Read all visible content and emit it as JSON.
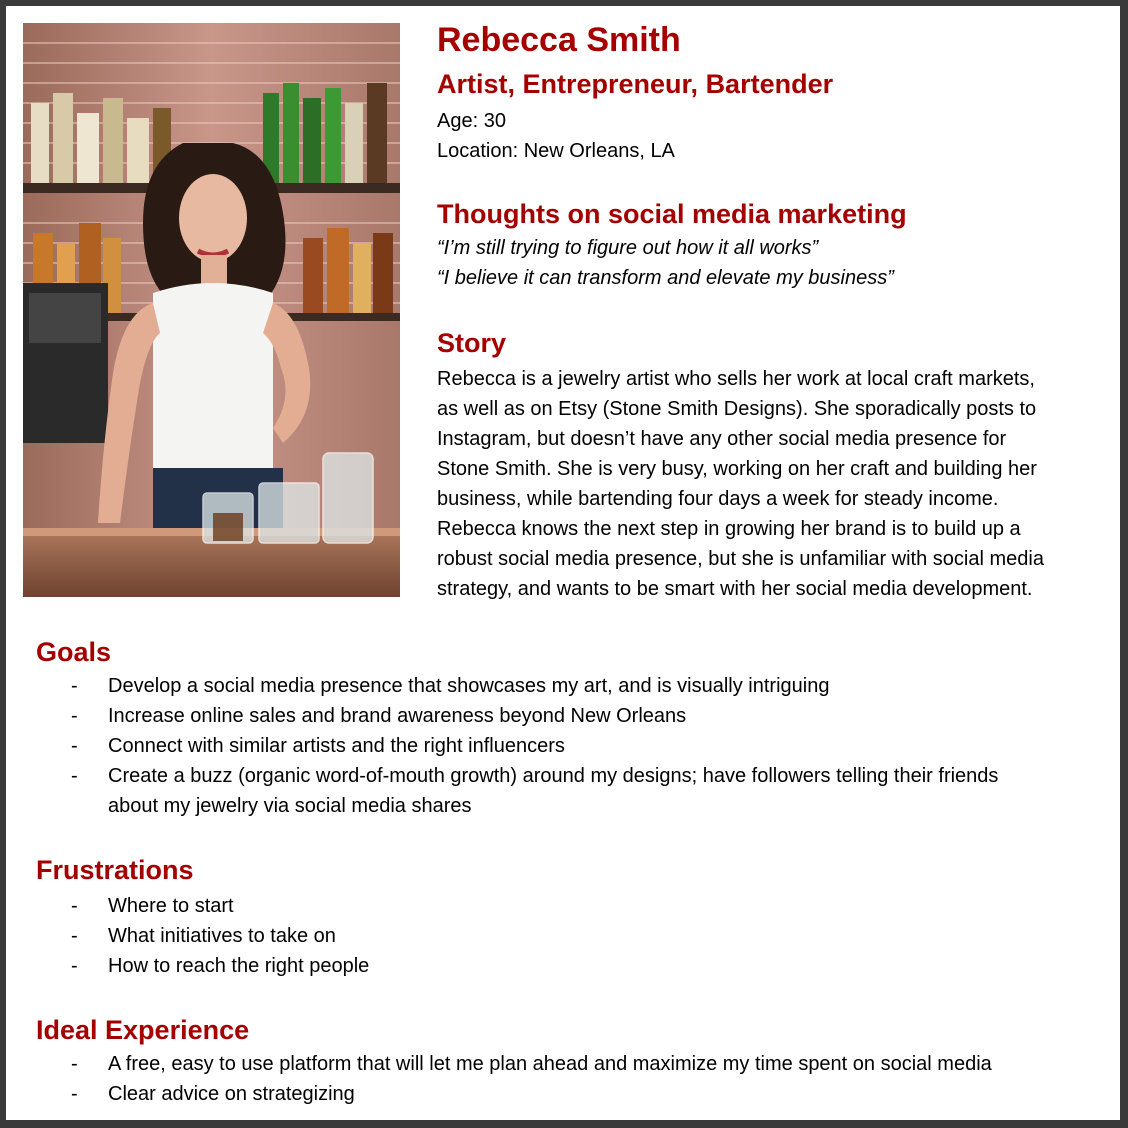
{
  "profile": {
    "name": "Rebecca Smith",
    "roles": "Artist, Entrepreneur, Bartender",
    "age": "Age: 30",
    "location": "Location: New Orleans, LA"
  },
  "thoughts": {
    "title": "Thoughts on social media marketing",
    "quotes": [
      "“I’m still trying to figure out how it all works”",
      "“I believe it can transform and elevate my business”"
    ]
  },
  "story": {
    "title": "Story",
    "lines": [
      "Rebecca is a jewelry artist who sells her work at local craft markets,",
      "as well as on Etsy (Stone Smith Designs). She sporadically posts to",
      "Instagram, but doesn’t have any other social media presence for",
      "Stone Smith. She is very busy, working on her craft and building her",
      "business, while bartending four days a week for steady income.",
      "Rebecca knows the next step in growing her brand is to build up a",
      "robust social media presence, but she is unfamiliar with social media",
      "strategy, and wants to be smart with her social media development."
    ]
  },
  "goals": {
    "title": "Goals",
    "items": [
      [
        "Develop a social media presence that showcases my art, and is visually intriguing"
      ],
      [
        "Increase online sales and brand awareness beyond New Orleans"
      ],
      [
        "Connect with similar artists and the right influencers"
      ],
      [
        "Create a buzz (organic word-of-mouth growth) around my designs; have followers telling their friends",
        "about my jewelry via social media shares"
      ]
    ]
  },
  "frustrations": {
    "title": "Frustrations",
    "items": [
      [
        "Where to start"
      ],
      [
        "What initiatives to take on"
      ],
      [
        "How to reach the right people"
      ]
    ]
  },
  "ideal": {
    "title": "Ideal Experience",
    "items": [
      [
        "A free, easy to use platform that will let me plan ahead and maximize my time spent on social media"
      ],
      [
        "Clear advice on strategizing"
      ]
    ]
  },
  "bullet_marker": "-",
  "colors": {
    "accent": "#a50000",
    "frame": "#3a3a3a",
    "background": "#ffffff"
  }
}
